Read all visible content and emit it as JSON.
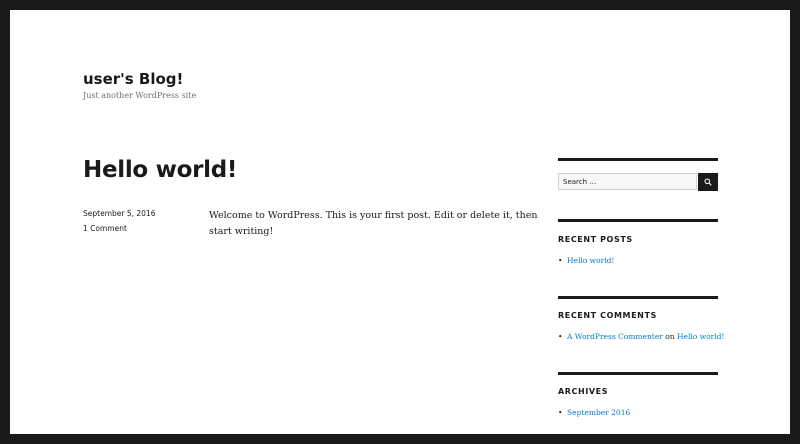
{
  "header": {
    "site_title": "user's Blog!",
    "site_description": "Just another WordPress site"
  },
  "post": {
    "title": "Hello world!",
    "date": "September 5, 2016",
    "comments": "1 Comment",
    "content": "Welcome to WordPress. This is your first post. Edit or delete it, then start writing!"
  },
  "sidebar": {
    "search": {
      "placeholder": "Search …",
      "icon": "search-icon"
    },
    "recent_posts": {
      "title": "RECENT POSTS",
      "items": [
        "Hello world!"
      ]
    },
    "recent_comments": {
      "title": "RECENT COMMENTS",
      "items": [
        {
          "author": "A WordPress Commenter",
          "on": "on",
          "post": "Hello world!"
        }
      ]
    },
    "archives": {
      "title": "ARCHIVES",
      "items": [
        "September 2016"
      ]
    }
  },
  "colors": {
    "frame": "#1a1a1a",
    "text": "#1a1a1a",
    "link": "#007acc",
    "secondary_text": "#707070"
  }
}
